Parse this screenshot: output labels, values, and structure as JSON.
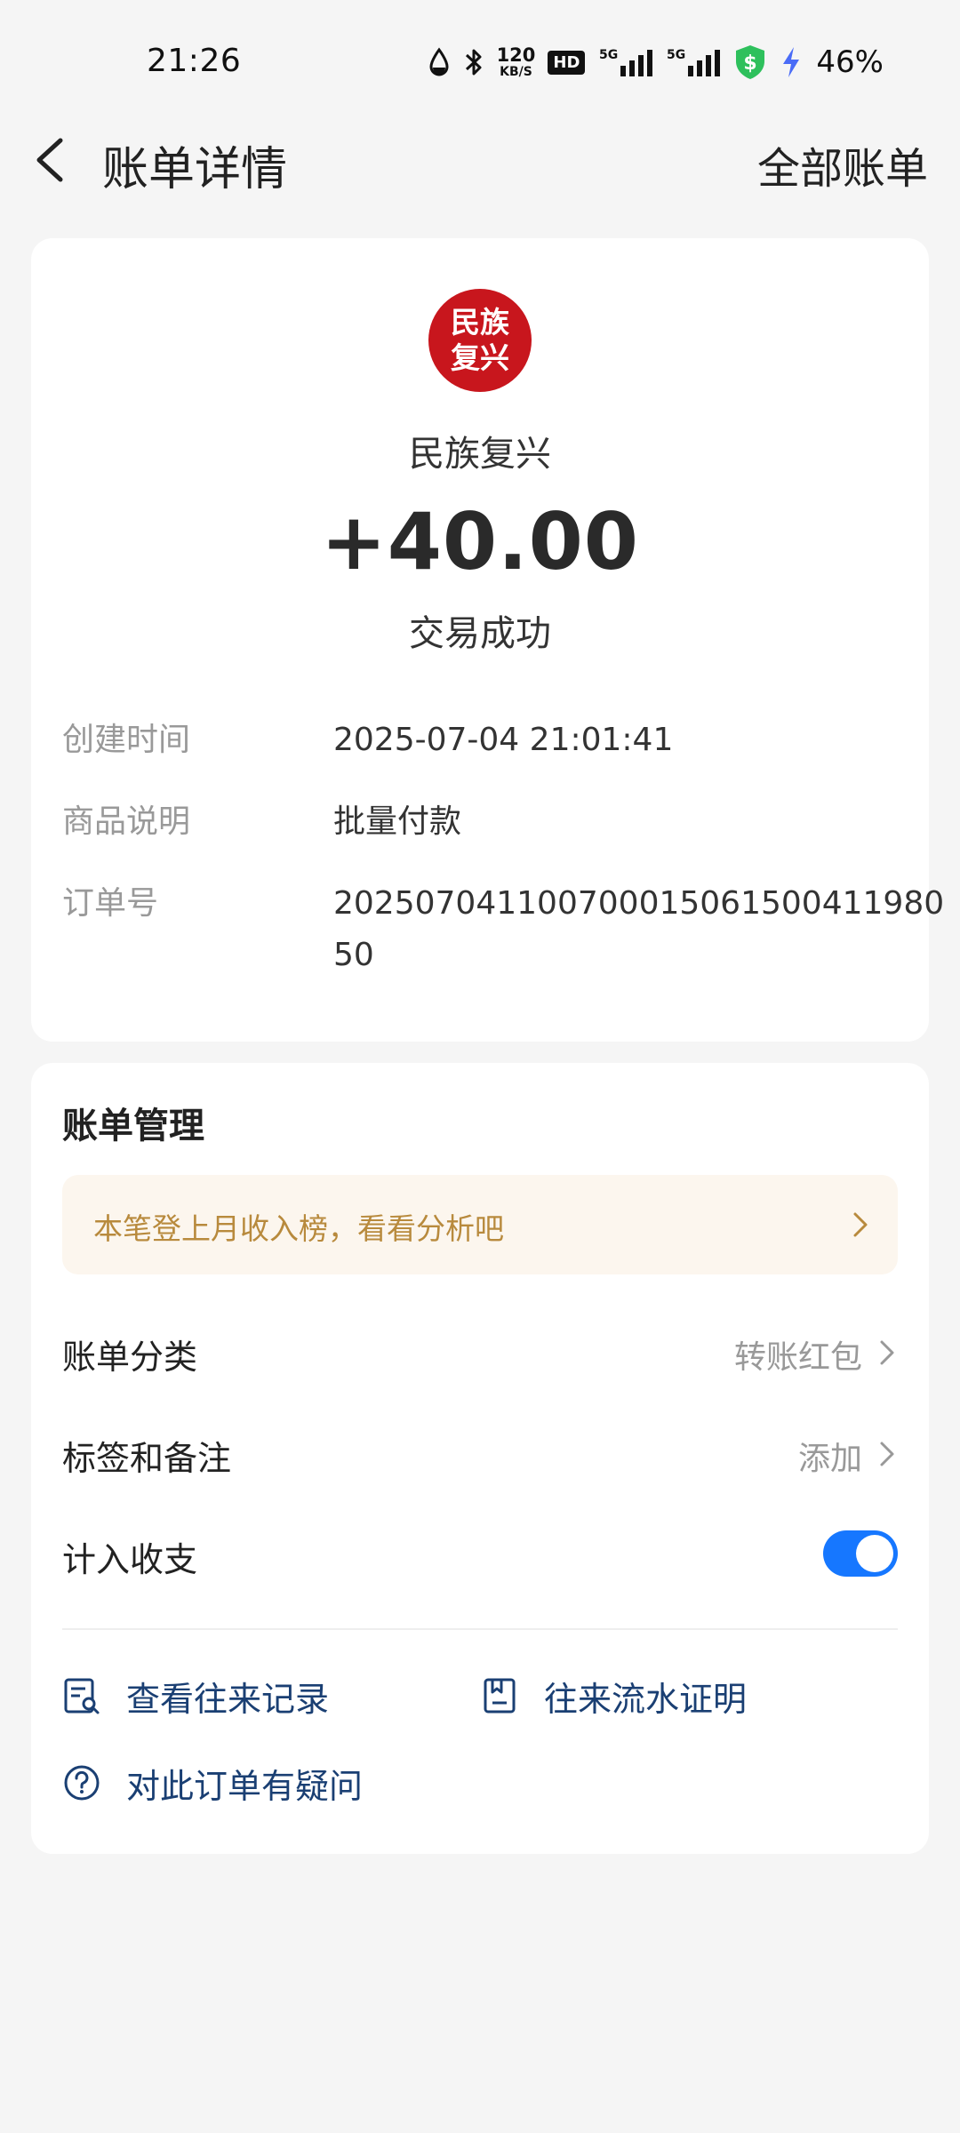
{
  "status_bar": {
    "time": "21:26",
    "net_speed_value": "120",
    "net_speed_unit": "KB/S",
    "hd_label": "HD",
    "network_1": "5G",
    "network_2": "5G",
    "battery_percent": "46%",
    "icons": [
      "water-drop-icon",
      "bluetooth-icon",
      "signal-icon",
      "shield-dollar-icon",
      "charging-icon"
    ]
  },
  "header": {
    "title": "账单详情",
    "right_action": "全部账单",
    "back_icon": "chevron-left-icon"
  },
  "transaction": {
    "avatar_text": "民族复兴",
    "merchant_name": "民族复兴",
    "amount": "+40.00",
    "status": "交易成功",
    "details": {
      "created_label": "创建时间",
      "created_value": "2025-07-04 21:01:41",
      "goods_label": "商品说明",
      "goods_value": "批量付款",
      "order_label": "订单号",
      "order_value": "20250704110070001506150041198050"
    }
  },
  "manage": {
    "title": "账单管理",
    "banner_text": "本笔登上月收入榜，看看分析吧",
    "category_label": "账单分类",
    "category_value": "转账红包",
    "tags_label": "标签和备注",
    "tags_value": "添加",
    "income_label": "计入收支",
    "income_toggle_on": true,
    "links": {
      "history": "查看往来记录",
      "proof": "往来流水证明",
      "question": "对此订单有疑问"
    }
  },
  "colors": {
    "accent_blue": "#1677ff",
    "link_blue": "#1a3f73",
    "avatar_red": "#c8161d",
    "banner_bg": "#fcf6ee",
    "banner_text": "#b88a3d"
  }
}
